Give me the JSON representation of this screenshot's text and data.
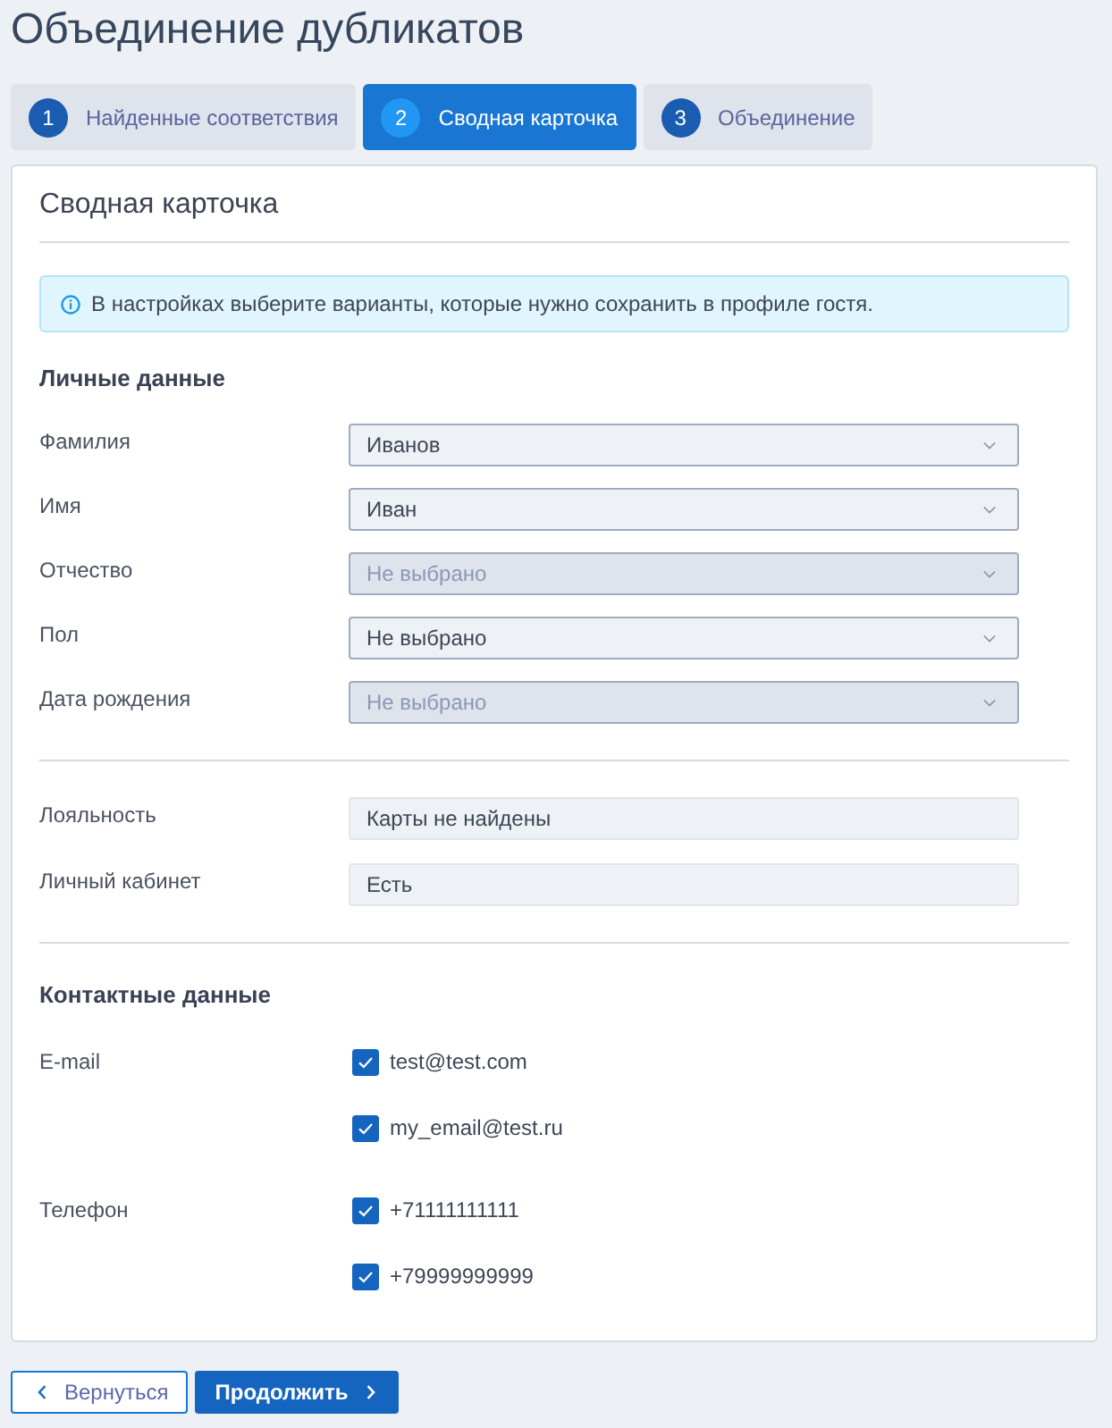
{
  "page": {
    "title": "Объединение дубликатов"
  },
  "steps": [
    {
      "number": "1",
      "label": "Найденные соответствия",
      "selected": false
    },
    {
      "number": "2",
      "label": "Сводная карточка",
      "selected": true
    },
    {
      "number": "3",
      "label": "Объединение",
      "selected": false
    }
  ],
  "card": {
    "title": "Сводная карточка",
    "info": "В настройках выберите варианты, которые нужно сохранить в профиле гостя.",
    "personal": {
      "heading": "Личные данные",
      "fields": [
        {
          "label": "Фамилия",
          "value": "Иванов",
          "disabled": false
        },
        {
          "label": "Имя",
          "value": "Иван",
          "disabled": false
        },
        {
          "label": "Отчество",
          "value": "Не выбрано",
          "disabled": true
        },
        {
          "label": "Пол",
          "value": "Не выбрано",
          "disabled": false
        },
        {
          "label": "Дата рождения",
          "value": "Не выбрано",
          "disabled": true
        }
      ]
    },
    "account": {
      "fields": [
        {
          "label": "Лояльность",
          "value": "Карты не найдены"
        },
        {
          "label": "Личный кабинет",
          "value": "Есть"
        }
      ]
    },
    "contacts": {
      "heading": "Контактные данные",
      "groups": [
        {
          "label": "E-mail",
          "options": [
            {
              "value": "test@test.com",
              "checked": true
            },
            {
              "value": "my_email@test.ru",
              "checked": true
            }
          ]
        },
        {
          "label": "Телефон",
          "options": [
            {
              "value": "+71111111111",
              "checked": true
            },
            {
              "value": "+79999999999",
              "checked": true
            }
          ]
        }
      ]
    }
  },
  "buttons": [
    {
      "kind": "back",
      "label": "Вернуться"
    },
    {
      "kind": "next",
      "label": "Продолжить"
    }
  ]
}
